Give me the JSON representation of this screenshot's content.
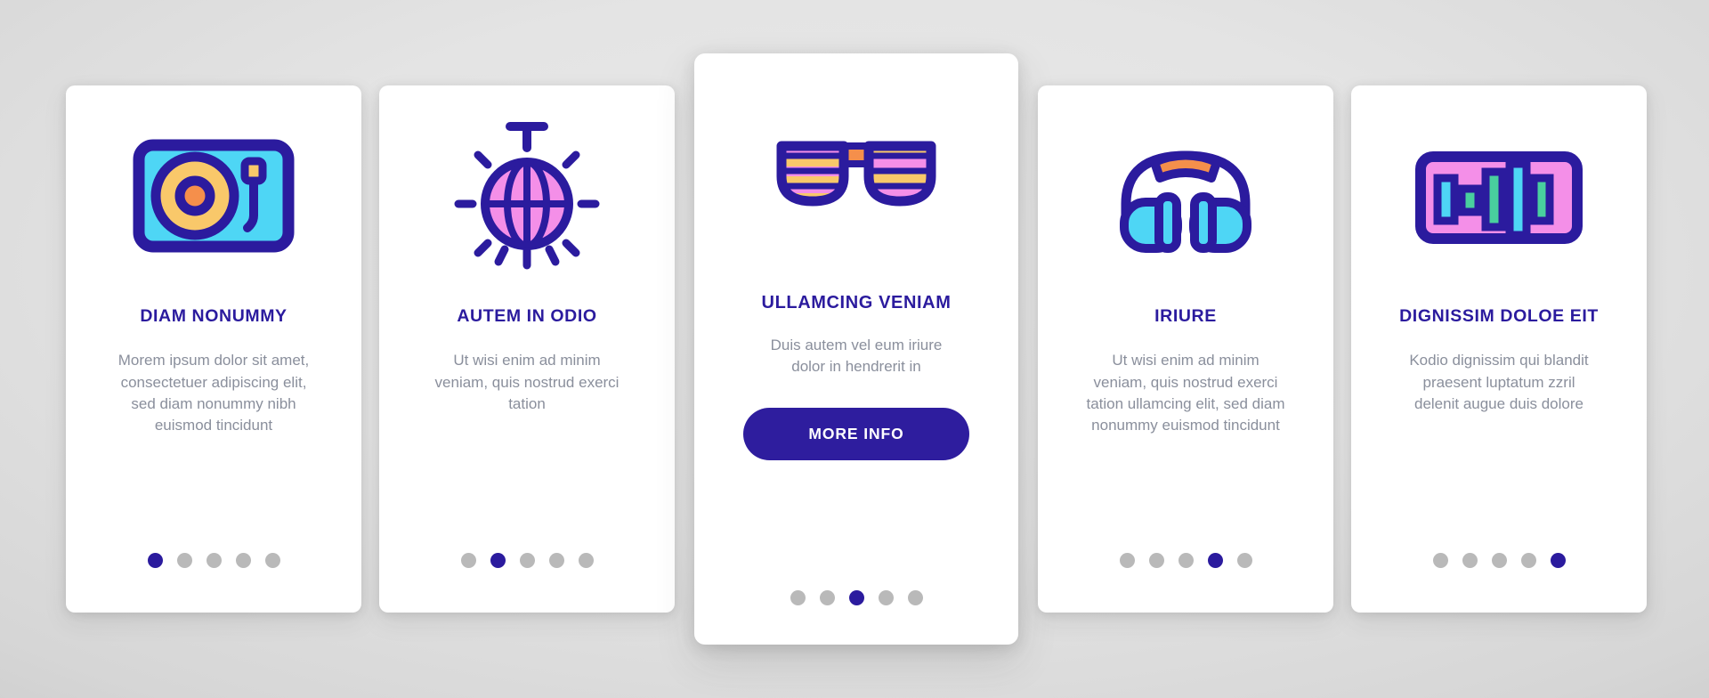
{
  "theme": {
    "brand_navy": "#2b1b9e",
    "button_bg": "#2e1d9e",
    "button_text": "#ffffff",
    "title_color": "#2b1b9e",
    "body_text_color": "#8a8f9c",
    "card_bg": "#ffffff",
    "dot_inactive": "#b9b9b9",
    "dot_active": "#2b1b9e",
    "icon_outline": "#2b1b9e",
    "icon_cyan": "#4ed6f5",
    "icon_pink": "#f48fe8",
    "icon_yellow": "#f9c86a",
    "icon_orange": "#f58f4b",
    "icon_green": "#49cf9e",
    "page_bg": "#d8d8d8"
  },
  "cards": [
    {
      "id": "card-1",
      "icon": "turntable-icon",
      "title": "DIAM NONUMMY",
      "description": "Morem ipsum dolor sit amet, consectetuer adipiscing elit, sed diam nonummy nibh euismod tincidunt",
      "dots": {
        "count": 5,
        "active_index": 0
      },
      "has_button": false,
      "featured": false
    },
    {
      "id": "card-2",
      "icon": "disco-ball-icon",
      "title": "AUTEM IN ODIO",
      "description": "Ut wisi enim ad minim veniam, quis nostrud exerci tation",
      "dots": {
        "count": 5,
        "active_index": 1
      },
      "has_button": false,
      "featured": false
    },
    {
      "id": "card-3",
      "icon": "shutter-sunglasses-icon",
      "title": "ULLAMCING VENIAM",
      "description": "Duis autem vel eum iriure dolor in hendrerit in",
      "button_label": "MORE INFO",
      "dots": {
        "count": 5,
        "active_index": 2
      },
      "has_button": true,
      "featured": true
    },
    {
      "id": "card-4",
      "icon": "headphones-icon",
      "title": "IRIURE",
      "description": "Ut wisi enim ad minim veniam, quis nostrud exerci tation ullamcing elit, sed diam nonummy euismod tincidunt",
      "dots": {
        "count": 5,
        "active_index": 3
      },
      "has_button": false,
      "featured": false
    },
    {
      "id": "card-5",
      "icon": "equalizer-icon",
      "title": "DIGNISSIM DOLOE EIT",
      "description": "Kodio dignissim qui blandit praesent luptatum zzril delenit augue duis dolore",
      "dots": {
        "count": 5,
        "active_index": 4
      },
      "has_button": false,
      "featured": false
    }
  ]
}
